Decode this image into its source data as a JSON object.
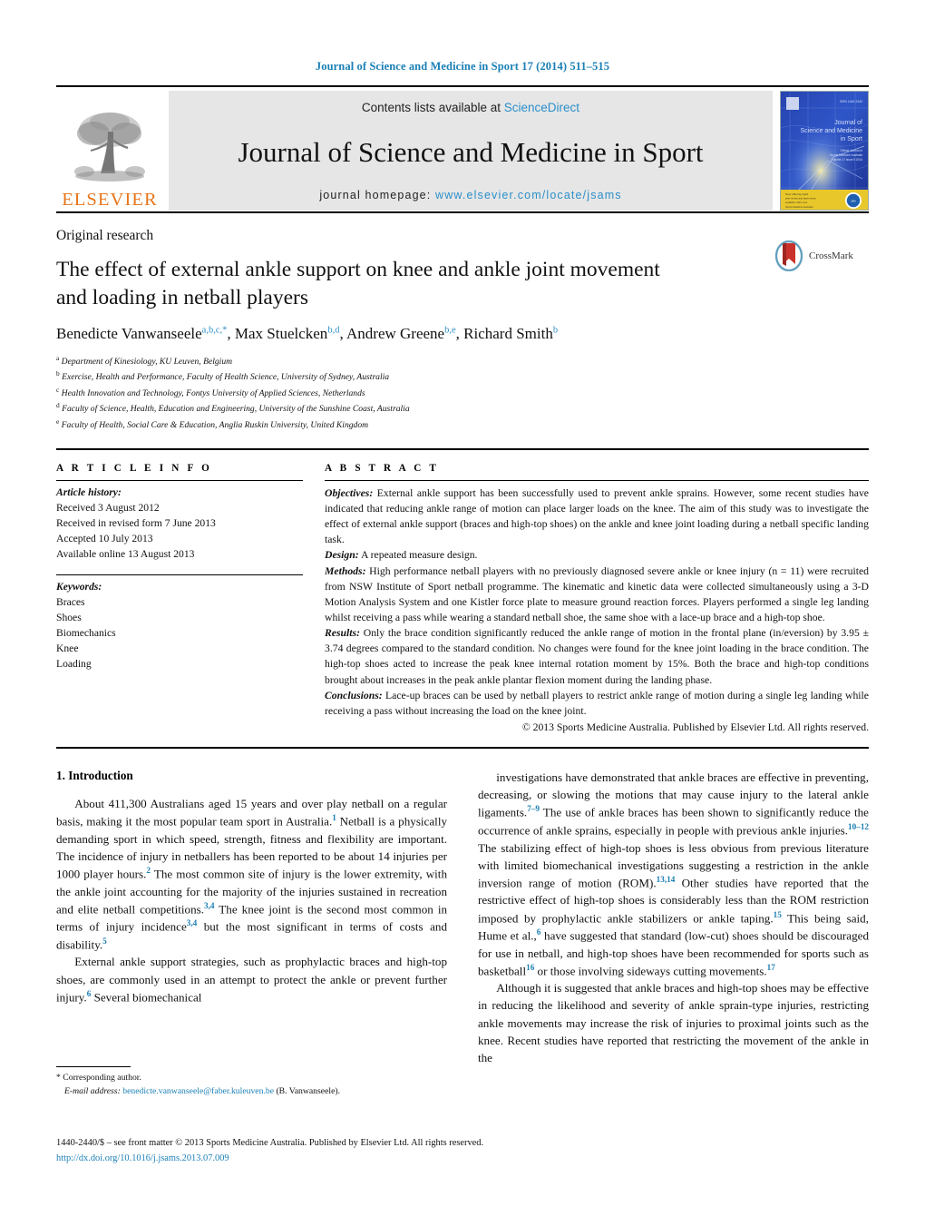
{
  "running_head": "Journal of Science and Medicine in Sport 17 (2014) 511–515",
  "masthead": {
    "contents_prefix": "Contents lists available at",
    "sciencedirect": "ScienceDirect",
    "journal_title": "Journal of Science and Medicine in Sport",
    "homepage_prefix": "journal homepage:",
    "homepage_url": "www.elsevier.com/locate/jsams",
    "publisher": "ELSEVIER",
    "cover_lines": [
      "Journal of",
      "Science and Medicine",
      "in Sport"
    ],
    "colors": {
      "link": "#2b8fc9",
      "elsevier_orange": "#E8751A",
      "panel_grey": "#e6e6e6",
      "cover_blue": "#1b3faa"
    }
  },
  "article": {
    "kicker": "Original research",
    "title": "The effect of external ankle support on knee and ankle joint movement and loading in netball players",
    "crossmark_label": "CrossMark",
    "authors_html": "Benedicte Vanwanseele<sup>a,b,c,*</sup>, Max Stuelcken<sup>b,d</sup>, Andrew Greene<sup>b,e</sup>, Richard Smith<sup>b</sup>",
    "affiliations": [
      {
        "mark": "a",
        "text": "Department of Kinesiology, KU Leuven, Belgium"
      },
      {
        "mark": "b",
        "text": "Exercise, Health and Performance, Faculty of Health Science, University of Sydney, Australia"
      },
      {
        "mark": "c",
        "text": "Health Innovation and Technology, Fontys University of Applied Sciences, Netherlands"
      },
      {
        "mark": "d",
        "text": "Faculty of Science, Health, Education and Engineering, University of the Sunshine Coast, Australia"
      },
      {
        "mark": "e",
        "text": "Faculty of Health, Social Care & Education, Anglia Ruskin University, United Kingdom"
      }
    ]
  },
  "article_info": {
    "heading": "A R T I C L E  I N F O",
    "history_label": "Article history:",
    "history": [
      "Received 3 August 2012",
      "Received in revised form 7 June 2013",
      "Accepted 10 July 2013",
      "Available online 13 August 2013"
    ],
    "keywords_label": "Keywords:",
    "keywords": [
      "Braces",
      "Shoes",
      "Biomechanics",
      "Knee",
      "Loading"
    ]
  },
  "abstract": {
    "heading": "A B S T R A C T",
    "sections": [
      {
        "label": "Objectives:",
        "text": " External ankle support has been successfully used to prevent ankle sprains. However, some recent studies have indicated that reducing ankle range of motion can place larger loads on the knee. The aim of this study was to investigate the effect of external ankle support (braces and high-top shoes) on the ankle and knee joint loading during a netball specific landing task."
      },
      {
        "label": "Design:",
        "text": " A repeated measure design."
      },
      {
        "label": "Methods:",
        "text": " High performance netball players with no previously diagnosed severe ankle or knee injury (n = 11) were recruited from NSW Institute of Sport netball programme. The kinematic and kinetic data were collected simultaneously using a 3-D Motion Analysis System and one Kistler force plate to measure ground reaction forces. Players performed a single leg landing whilst receiving a pass while wearing a standard netball shoe, the same shoe with a lace-up brace and a high-top shoe."
      },
      {
        "label": "Results:",
        "text": " Only the brace condition significantly reduced the ankle range of motion in the frontal plane (in/eversion) by 3.95 ± 3.74 degrees compared to the standard condition. No changes were found for the knee joint loading in the brace condition. The high-top shoes acted to increase the peak knee internal rotation moment by 15%. Both the brace and high-top conditions brought about increases in the peak ankle plantar flexion moment during the landing phase."
      },
      {
        "label": "Conclusions:",
        "text": " Lace-up braces can be used by netball players to restrict ankle range of motion during a single leg landing while receiving a pass without increasing the load on the knee joint."
      }
    ],
    "copyright": "© 2013 Sports Medicine Australia. Published by Elsevier Ltd. All rights reserved."
  },
  "body": {
    "section_heading": "1.  Introduction",
    "left_paragraphs": [
      "About 411,300 Australians aged 15 years and over play netball on a regular basis, making it the most popular team sport in Australia.|1| Netball is a physically demanding sport in which speed, strength, fitness and flexibility are important. The incidence of injury in netballers has been reported to be about 14 injuries per 1000 player hours.|2| The most common site of injury is the lower extremity, with the ankle joint accounting for the majority of the injuries sustained in recreation and elite netball competitions.|3,4| The knee joint is the second most common in terms of injury incidence|3,4| but the most significant in terms of costs and disability.|5|",
      "External ankle support strategies, such as prophylactic braces and high-top shoes, are commonly used in an attempt to protect the ankle or prevent further injury.|6| Several biomechanical"
    ],
    "right_paragraphs": [
      "investigations have demonstrated that ankle braces are effective in preventing, decreasing, or slowing the motions that may cause injury to the lateral ankle ligaments.|7–9| The use of ankle braces has been shown to significantly reduce the occurrence of ankle sprains, especially in people with previous ankle injuries.|10–12| The stabilizing effect of high-top shoes is less obvious from previous literature with limited biomechanical investigations suggesting a restriction in the ankle inversion range of motion (ROM).|13,14| Other studies have reported that the restrictive effect of high-top shoes is considerably less than the ROM restriction imposed by prophylactic ankle stabilizers or ankle taping.|15| This being said, Hume et al.,|6| have suggested that standard (low-cut) shoes should be discouraged for use in netball, and high-top shoes have been recommended for sports such as basketball|16| or those involving sideways cutting movements.|17|",
      "Although it is suggested that ankle braces and high-top shoes may be effective in reducing the likelihood and severity of ankle sprain-type injuries, restricting ankle movements may increase the risk of injuries to proximal joints such as the knee. Recent studies have reported that restricting the movement of the ankle in the"
    ]
  },
  "footnote": {
    "star_line": "* Corresponding author.",
    "email_label": "E-mail address:",
    "email": "benedicte.vanwanseele@faber.kuleuven.be",
    "email_suffix": "(B. Vanwanseele)."
  },
  "bottom": {
    "frontmatter": "1440-2440/$ – see front matter © 2013 Sports Medicine Australia. Published by Elsevier Ltd. All rights reserved.",
    "doi": "http://dx.doi.org/10.1016/j.jsams.2013.07.009"
  }
}
